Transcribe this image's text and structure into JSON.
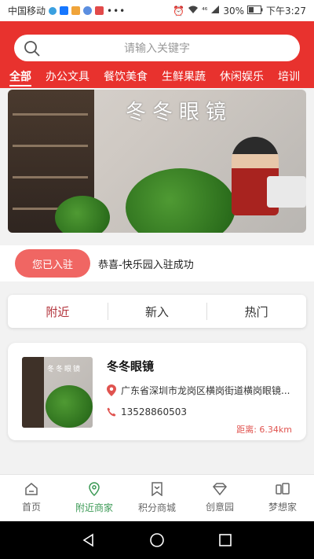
{
  "status_bar": {
    "carrier": "中国移动",
    "extra": "⁴⁶",
    "battery": "30%",
    "time": "下午3:27"
  },
  "search": {
    "placeholder": "请输入关键字"
  },
  "categories": [
    "全部",
    "办公文具",
    "餐饮美食",
    "生鲜果蔬",
    "休闲娱乐",
    "培训"
  ],
  "banner": {
    "sign_text": "冬冬眼镜"
  },
  "joined": {
    "button_label": "您已入驻",
    "message": "恭喜-快乐园入驻成功"
  },
  "tabs": [
    "附近",
    "新入",
    "热门"
  ],
  "merchant": {
    "name": "冬冬眼镜",
    "address": "广东省深圳市龙岗区横岗街道横岗眼镜...",
    "phone": "13528860503",
    "distance": "距离: 6.34km",
    "thumb_sign": "冬冬眼镜"
  },
  "bottom_nav": [
    {
      "label": "首页",
      "icon": "home-icon"
    },
    {
      "label": "附近商家",
      "icon": "location-pin-icon"
    },
    {
      "label": "积分商城",
      "icon": "bookmark-icon"
    },
    {
      "label": "创意园",
      "icon": "diamond-icon"
    },
    {
      "label": "梦想家",
      "icon": "dream-icon"
    }
  ],
  "colors": {
    "brand_red": "#e8322e",
    "pill_red": "#f06663",
    "tab_active": "#b2323a",
    "nav_active": "#3c9a56",
    "distance": "#e0534f"
  }
}
